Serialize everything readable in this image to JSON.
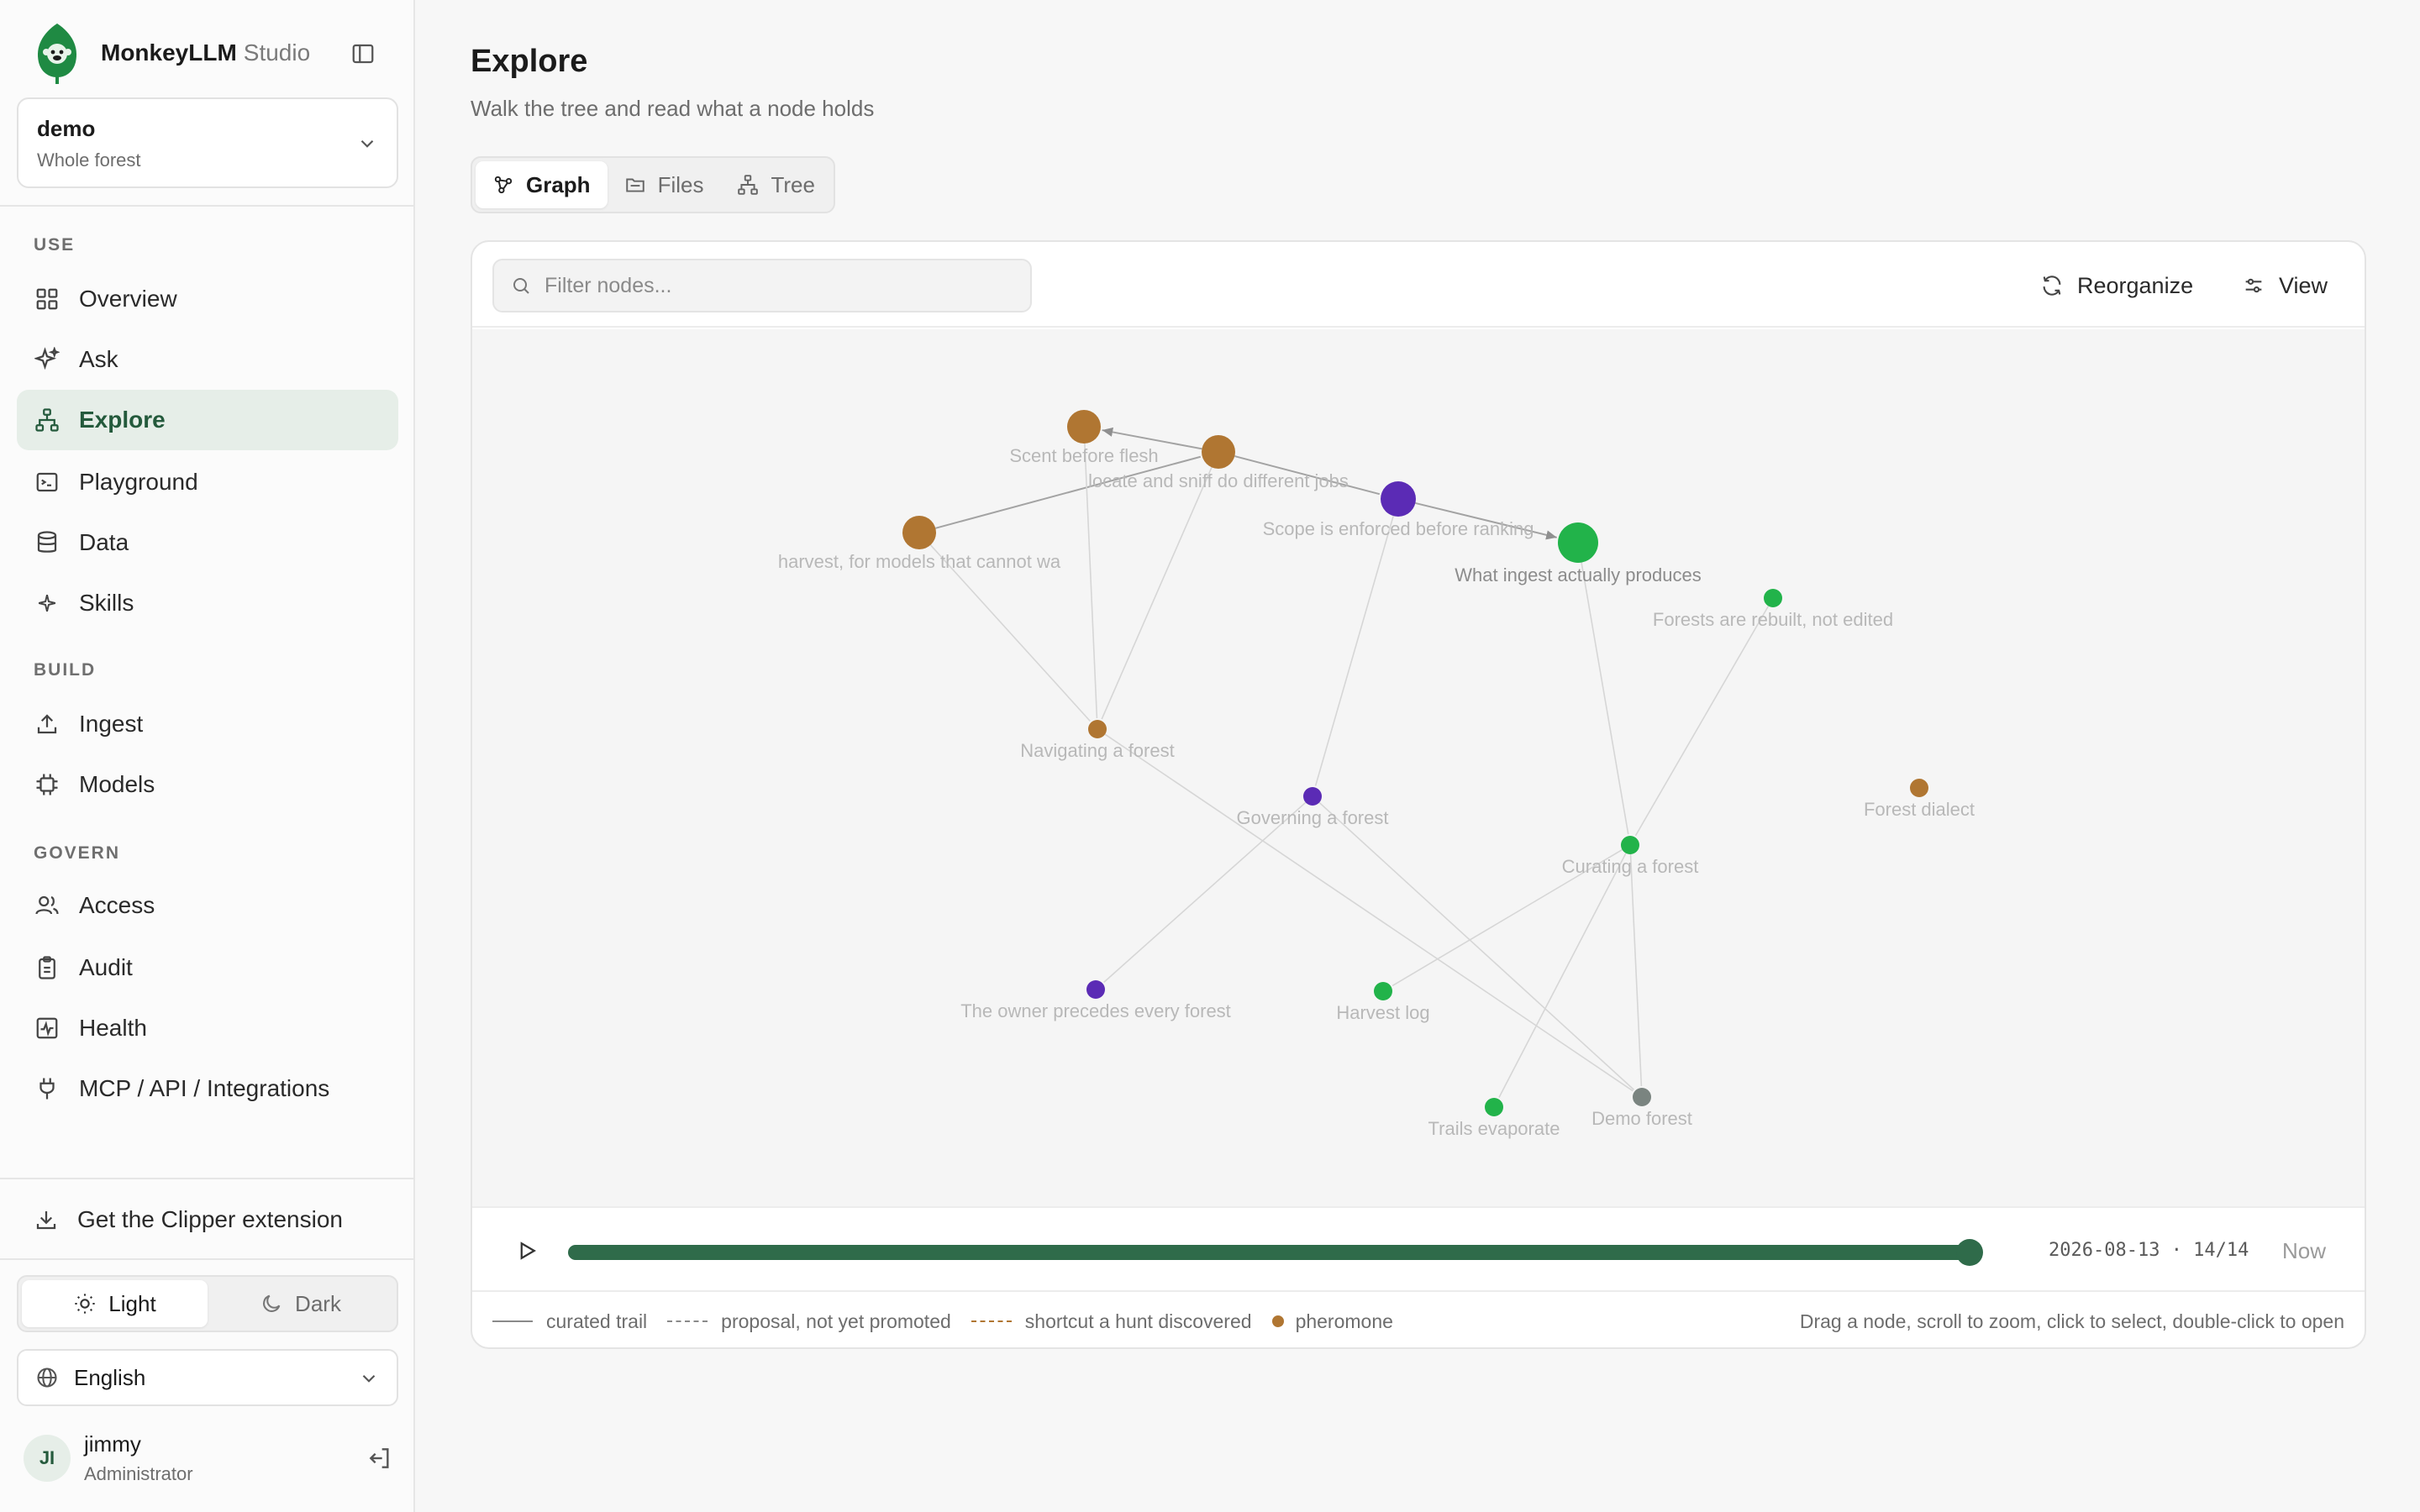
{
  "brand": {
    "name": "MonkeyLLM",
    "suffix": "Studio"
  },
  "workspace": {
    "name": "demo",
    "scope": "Whole forest"
  },
  "sidebar": {
    "sections": [
      {
        "label": "USE",
        "items": [
          {
            "label": "Overview",
            "icon": "grid-icon"
          },
          {
            "label": "Ask",
            "icon": "sparkle-icon"
          },
          {
            "label": "Explore",
            "icon": "hierarchy-icon",
            "active": true
          },
          {
            "label": "Playground",
            "icon": "terminal-icon"
          },
          {
            "label": "Data",
            "icon": "database-icon"
          },
          {
            "label": "Skills",
            "icon": "star-icon"
          }
        ]
      },
      {
        "label": "BUILD",
        "items": [
          {
            "label": "Ingest",
            "icon": "upload-icon"
          },
          {
            "label": "Models",
            "icon": "cpu-icon"
          }
        ]
      },
      {
        "label": "GOVERN",
        "items": [
          {
            "label": "Access",
            "icon": "users-icon"
          },
          {
            "label": "Audit",
            "icon": "clipboard-icon"
          },
          {
            "label": "Health",
            "icon": "activity-icon"
          },
          {
            "label": "MCP / API / Integrations",
            "icon": "plug-icon"
          }
        ]
      }
    ],
    "clipper": "Get the Clipper extension",
    "theme": {
      "light": "Light",
      "dark": "Dark",
      "selected": "Light"
    },
    "language": "English",
    "user": {
      "initials": "JI",
      "name": "jimmy",
      "role": "Administrator"
    }
  },
  "page": {
    "title": "Explore",
    "subtitle": "Walk the tree and read what a node holds",
    "tabs": [
      {
        "label": "Graph",
        "icon": "graph-icon",
        "active": true
      },
      {
        "label": "Files",
        "icon": "folder-icon"
      },
      {
        "label": "Tree",
        "icon": "tree-icon"
      }
    ]
  },
  "toolbar": {
    "filter_placeholder": "Filter nodes...",
    "reorganize": "Reorganize",
    "view": "View"
  },
  "colors": {
    "accent": "#2f6b4a",
    "pheromone": "#b07632",
    "purple": "#5b2bb5",
    "green": "#22b34a",
    "gray": "#7a8480"
  },
  "graph": {
    "nodes": [
      {
        "id": "scent",
        "label": "Scent before flesh",
        "color": "pheromone"
      },
      {
        "id": "locate",
        "label": "locate and sniff do different jobs",
        "color": "pheromone"
      },
      {
        "id": "harvest",
        "label": "harvest, for models that cannot wa",
        "color": "pheromone"
      },
      {
        "id": "scope",
        "label": "Scope is enforced before ranking",
        "color": "purple"
      },
      {
        "id": "ingest",
        "label": "What ingest actually produces",
        "color": "green"
      },
      {
        "id": "rebuilt",
        "label": "Forests are rebuilt, not edited",
        "color": "green"
      },
      {
        "id": "navigating",
        "label": "Navigating a forest",
        "color": "pheromone"
      },
      {
        "id": "governing",
        "label": "Governing a forest",
        "color": "purple"
      },
      {
        "id": "dialect",
        "label": "Forest dialect",
        "color": "pheromone"
      },
      {
        "id": "curating",
        "label": "Curating a forest",
        "color": "green"
      },
      {
        "id": "owner",
        "label": "The owner precedes every forest",
        "color": "purple"
      },
      {
        "id": "harvestlog",
        "label": "Harvest log",
        "color": "green"
      },
      {
        "id": "trails",
        "label": "Trails evaporate",
        "color": "green"
      },
      {
        "id": "demo",
        "label": "Demo forest",
        "color": "gray"
      }
    ]
  },
  "timeline": {
    "date": "2026-08-13 · 14/14",
    "now": "Now",
    "progress": 1.0
  },
  "legend": {
    "curated": "curated trail",
    "proposal": "proposal, not yet promoted",
    "shortcut": "shortcut a hunt discovered",
    "pheromone": "pheromone",
    "hint": "Drag a node, scroll to zoom, click to select, double-click to open"
  }
}
